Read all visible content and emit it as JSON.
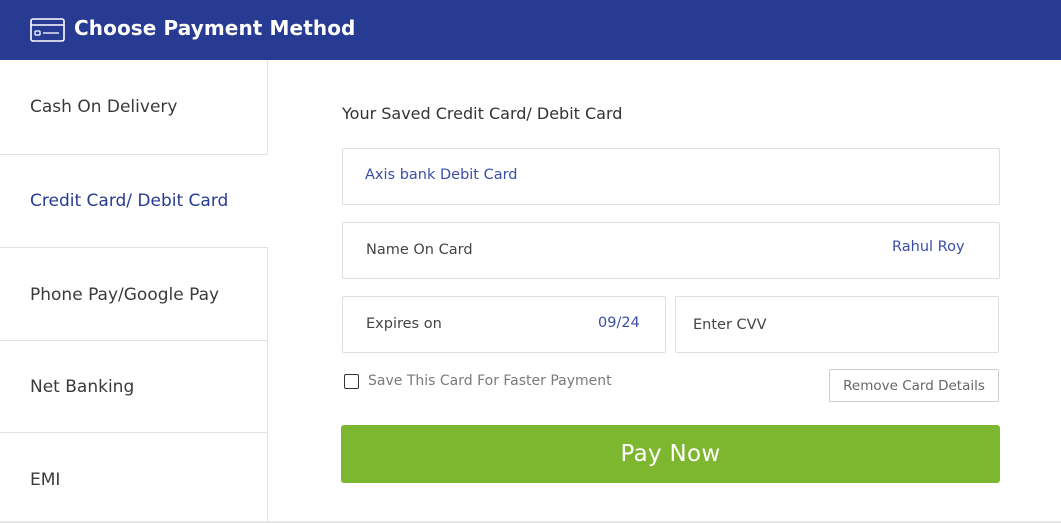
{
  "header": {
    "title": "Choose Payment Method",
    "icon": "credit-card-icon",
    "background_color": "#283b93"
  },
  "sidebar": {
    "items": [
      {
        "label": "Cash On Delivery",
        "active": false
      },
      {
        "label": "Credit Card/ Debit Card",
        "active": true
      },
      {
        "label": "Phone Pay/Google Pay",
        "active": false
      },
      {
        "label": "Net Banking",
        "active": false
      },
      {
        "label": "EMI",
        "active": false
      }
    ],
    "active_color": "#283b93"
  },
  "main": {
    "section_title": "Your Saved Credit Card/ Debit Card",
    "saved_card": "Axis bank Debit Card",
    "name_on_card": {
      "label": "Name On Card",
      "value": "Rahul Roy"
    },
    "expiry": {
      "label": "Expires on",
      "value": "09/24"
    },
    "cvv": {
      "placeholder": "Enter CVV",
      "value": ""
    },
    "save_card": {
      "label": "Save This Card For Faster Payment",
      "checked": false
    },
    "remove_button": "Remove Card Details",
    "pay_button": "Pay Now",
    "pay_button_color": "#7db72f"
  }
}
